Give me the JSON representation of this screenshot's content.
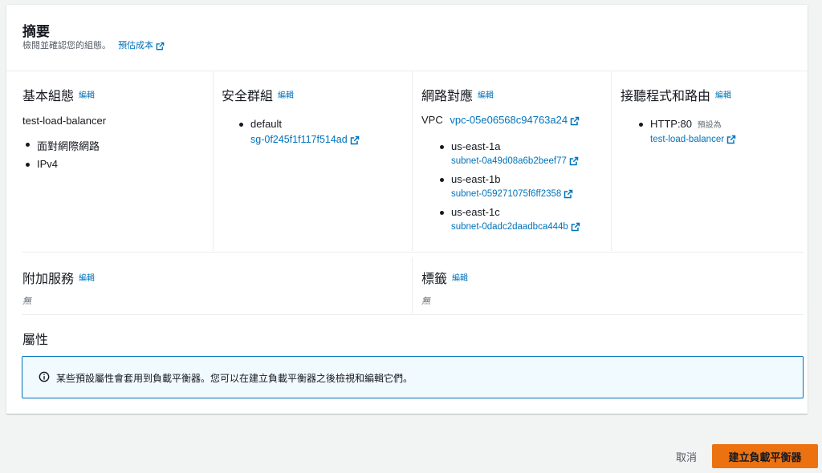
{
  "summary": {
    "title": "摘要",
    "description": "檢閱並確認您的組態。",
    "cost_link": "預估成本"
  },
  "edit_label": "編輯",
  "basic_config": {
    "title": "基本組態",
    "name": "test-load-balancer",
    "items": [
      "面對網際網路",
      "IPv4"
    ]
  },
  "security_groups": {
    "title": "安全群組",
    "group_name": "default",
    "group_id": "sg-0f245f1f117f514ad"
  },
  "network_mapping": {
    "title": "網路對應",
    "vpc_label": "VPC",
    "vpc_id": "vpc-05e06568c94763a24",
    "subnets": [
      {
        "az": "us-east-1a",
        "subnet": "subnet-0a49d08a6b2beef77"
      },
      {
        "az": "us-east-1b",
        "subnet": "subnet-059271075f6ff2358"
      },
      {
        "az": "us-east-1c",
        "subnet": "subnet-0dadc2daadbca444b"
      }
    ]
  },
  "listeners": {
    "title": "接聽程式和路由",
    "listener": "HTTP:80",
    "default_label": "預設為",
    "target": "test-load-balancer"
  },
  "addon_services": {
    "title": "附加服務",
    "value": "無"
  },
  "tags": {
    "title": "標籤",
    "value": "無"
  },
  "attributes": {
    "title": "屬性",
    "info_text": "某些預設屬性會套用到負載平衡器。您可以在建立負載平衡器之後檢視和編輯它們。"
  },
  "footer": {
    "cancel_label": "取消",
    "create_label": "建立負載平衡器"
  },
  "colors": {
    "link": "#0073bb",
    "primary_button": "#ec7211",
    "info_border": "#0073bb",
    "info_background": "#f1faff"
  }
}
